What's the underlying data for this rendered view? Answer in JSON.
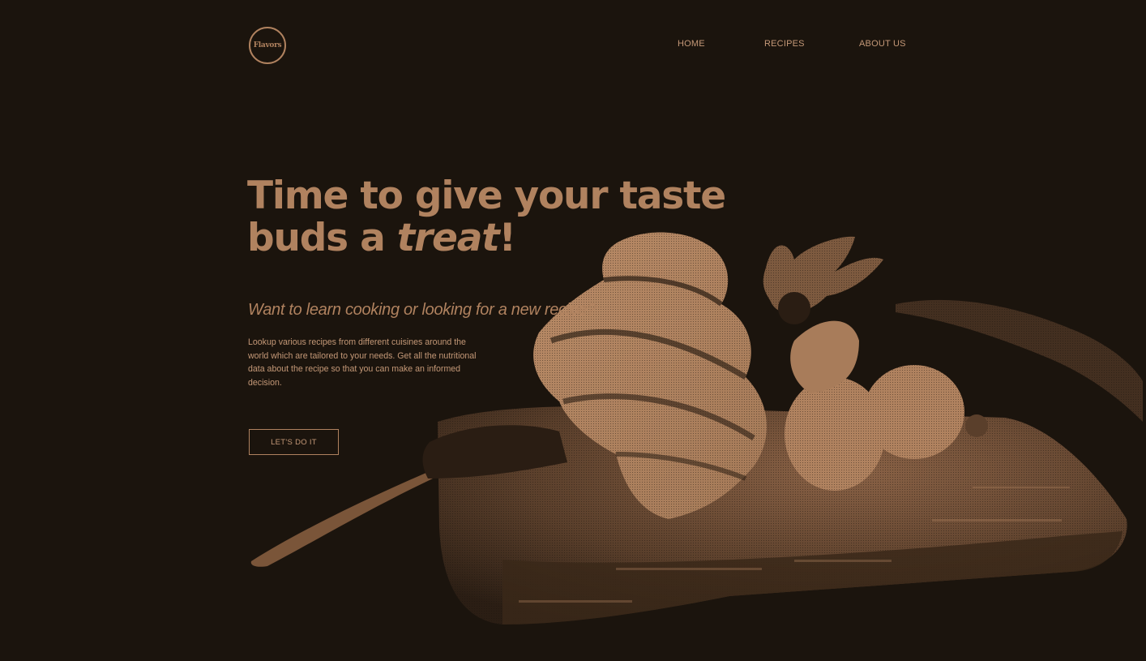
{
  "brand": {
    "logo_text": "Flavors"
  },
  "nav": {
    "home": "HOME",
    "recipes": "RECIPES",
    "about": "ABOUT US"
  },
  "hero": {
    "headline_line1": "Time to give your taste",
    "headline_line2_prefix": "buds a ",
    "headline_emphasis": "treat",
    "headline_suffix": "!",
    "subheading": "Want to learn cooking or looking for a new recipe?",
    "description": "Lookup various recipes from different cuisines around the world which are tailored to your needs. Get all the nutritional data about the recipe so that you can make an informed decision.",
    "cta_label": "LET'S DO IT"
  },
  "colors": {
    "background": "#1b140d",
    "accent": "#b0825f"
  },
  "icons": {
    "hero_image": "meringue-dessert-on-cutting-board-image"
  }
}
